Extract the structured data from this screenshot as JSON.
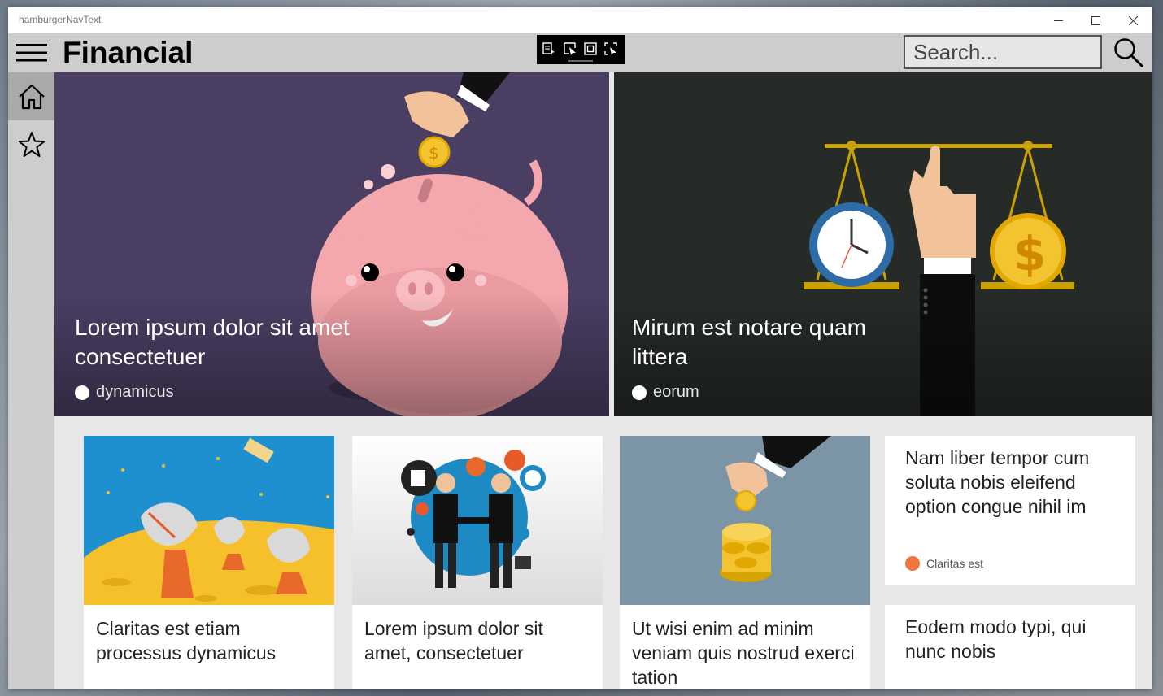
{
  "window": {
    "title": "hamburgerNavText"
  },
  "header": {
    "title": "Financial"
  },
  "search": {
    "placeholder": "Search..."
  },
  "nav": {
    "items": [
      {
        "name": "home"
      },
      {
        "name": "favorites"
      }
    ]
  },
  "colors": {
    "header_bg": "#cdcdcd",
    "hero1_bg": "#4a3e63",
    "hero2_bg": "#262b27",
    "accent_orange": "#f07440"
  },
  "hero": [
    {
      "title": "Lorem ipsum dolor sit amet consectetuer",
      "tag": "dynamicus",
      "dot_color": "#ffffff"
    },
    {
      "title": "Mirum est notare quam littera",
      "tag": "eorum",
      "dot_color": "#ffffff"
    }
  ],
  "cards": [
    {
      "title": "Claritas est etiam processus dynamicus",
      "image": "satellite-dishes"
    },
    {
      "title": "Lorem ipsum dolor sit amet, consectetuer",
      "image": "business-handshake"
    },
    {
      "title": "Ut wisi enim ad minim veniam quis nostrud exerci tation",
      "image": "coins-hand"
    },
    {
      "title": "Nam liber tempor cum soluta nobis eleifend option congue nihil im",
      "tag": "Claritas est",
      "dot_color": "#f07440"
    },
    {
      "title": "Eodem modo typi, qui nunc nobis"
    }
  ]
}
